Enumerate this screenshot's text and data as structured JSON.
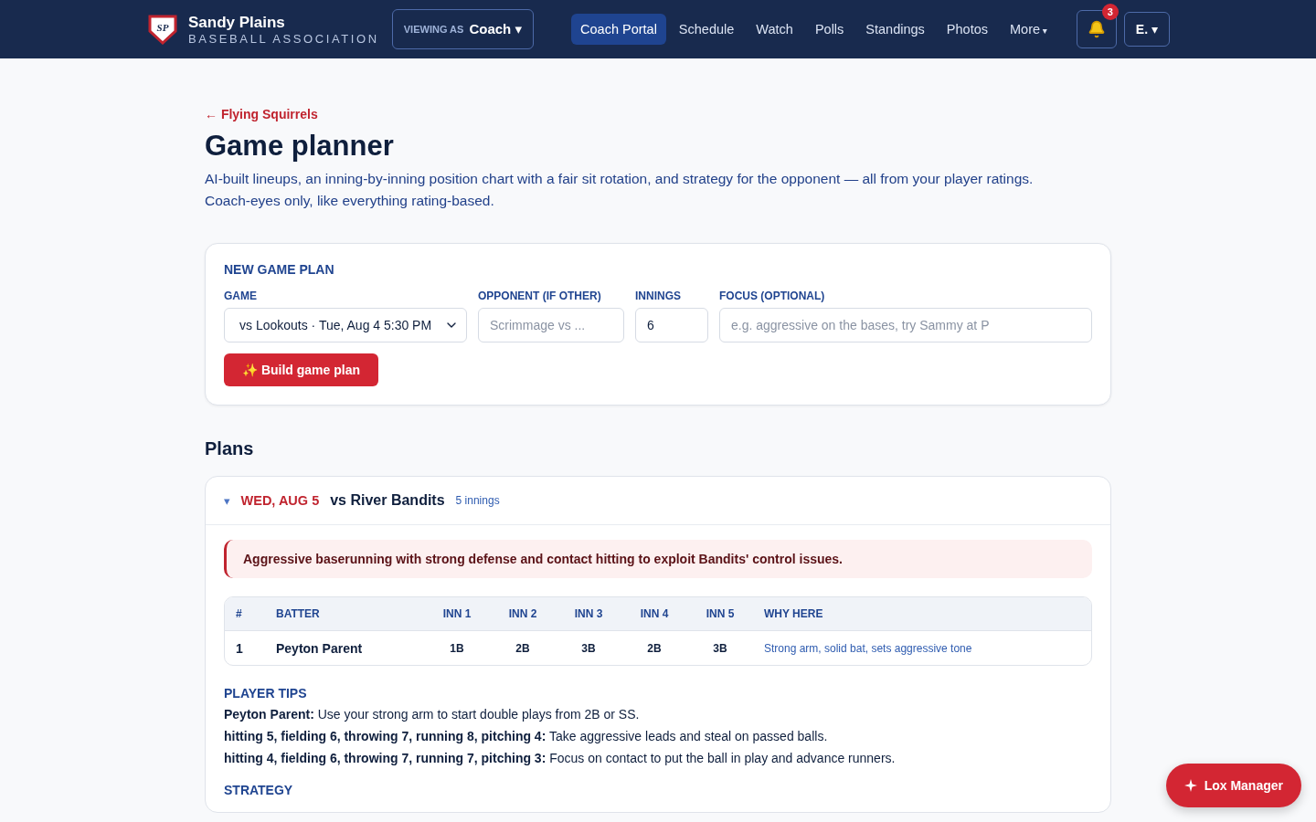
{
  "header": {
    "logo": "SP",
    "org_name": "Sandy Plains",
    "org_subtitle": "BASEBALL ASSOCIATION",
    "viewing_as": {
      "label": "VIEWING AS",
      "value": "Coach",
      "caret": "▾"
    },
    "nav": [
      {
        "label": "Coach Portal",
        "selected": true
      },
      {
        "label": "Schedule",
        "selected": false
      },
      {
        "label": "Watch",
        "selected": false
      },
      {
        "label": "Polls",
        "selected": false
      },
      {
        "label": "Standings",
        "selected": false
      },
      {
        "label": "Photos",
        "selected": false
      },
      {
        "label": "More",
        "selected": false,
        "caret": "▾"
      }
    ],
    "notifications": {
      "count": "3"
    },
    "user_menu": {
      "label": "E.",
      "caret": "▾"
    }
  },
  "back_link": "← Flying Squirrels",
  "title": "Game planner",
  "intro": "AI-built lineups, an inning-by-inning position chart with a fair sit rotation, and strategy for the opponent — all from your player ratings. Coach-eyes only, like everything rating-based.",
  "new_plan": {
    "heading": "NEW GAME PLAN",
    "fields": [
      {
        "kind": "select",
        "label": "GAME",
        "value": "vs Lookouts · Tue, Aug 4 5:30 PM"
      },
      {
        "kind": "input",
        "label": "OPPONENT (IF OTHER)",
        "placeholder": "Scrimmage vs ..."
      },
      {
        "kind": "input",
        "label": "INNINGS",
        "value": "6"
      },
      {
        "kind": "input",
        "label": "FOCUS (OPTIONAL)",
        "placeholder": "e.g. aggressive on the bases, try Sammy at P"
      }
    ],
    "button": "✨ Build game plan"
  },
  "plans_heading": "Plans",
  "plans": [
    {
      "expanded": true,
      "toggle": "▾",
      "date": "WED, AUG 5",
      "opponent": "vs River Bandits",
      "innings": "5 innings",
      "summary": "Aggressive baserunning with strong defense and contact hitting to exploit Bandits' control issues.",
      "table": {
        "columns": [
          "#",
          "BATTER",
          "INN 1",
          "INN 2",
          "INN 3",
          "INN 4",
          "INN 5",
          "WHY HERE"
        ],
        "rows": [
          [
            "1",
            "Peyton Parent",
            "1B",
            "2B",
            "3B",
            "2B",
            "3B",
            "Strong arm, solid bat, sets aggressive tone"
          ]
        ]
      },
      "tips_heading": "PLAYER TIPS",
      "tips": [
        "**Peyton Parent:** Use your strong arm to start double plays from 2B or SS.",
        "**hitting 5, fielding 6, throwing 7, running 8, pitching 4:** Take aggressive leads and steal on passed balls.",
        "**hitting 4, fielding 6, throwing 7, running 7, pitching 3:** Focus on contact to put the ball in play and advance runners."
      ],
      "strategy_heading": "STRATEGY"
    }
  ],
  "assistant_button": "Lox Manager"
}
